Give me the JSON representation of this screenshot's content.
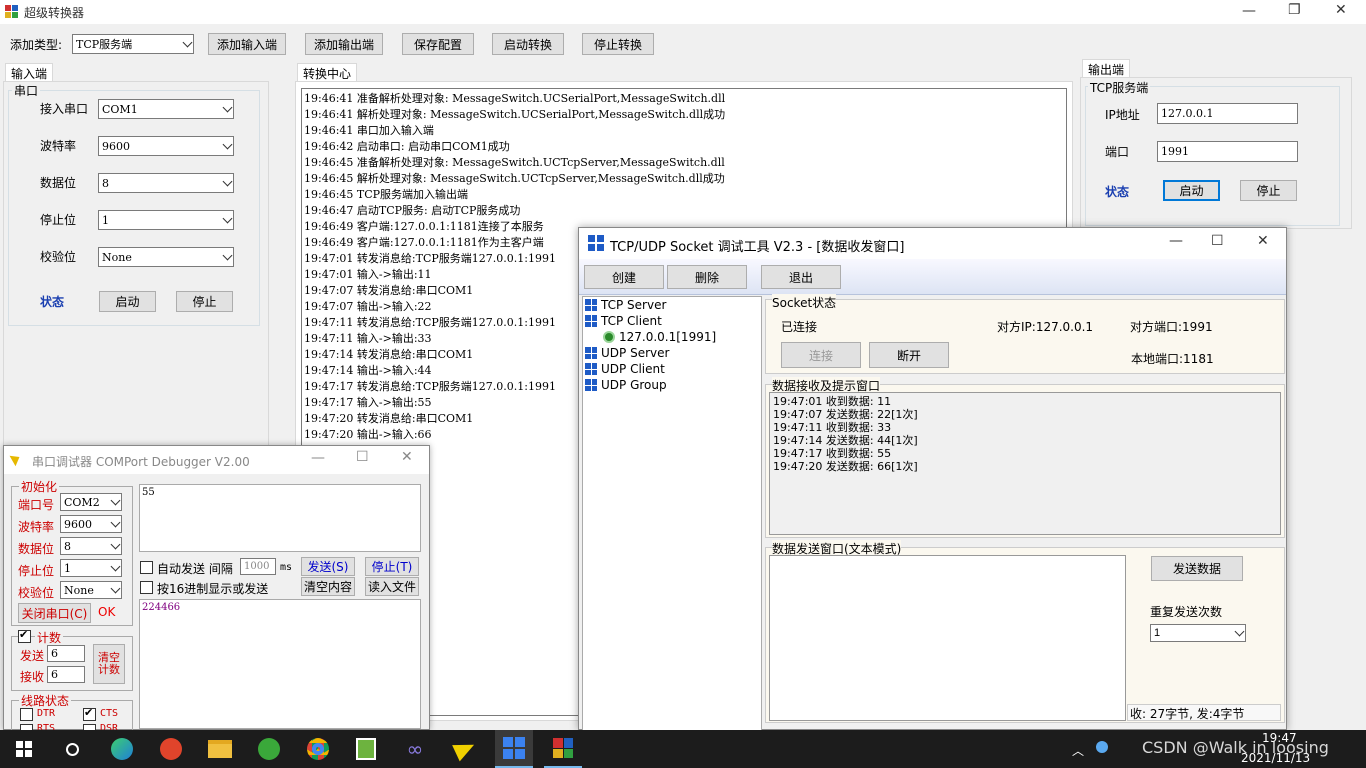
{
  "main_window": {
    "title": "超级转换器",
    "controls": {
      "min": "—",
      "max": "❐",
      "close": "✕"
    },
    "toolbar": {
      "add_type_label": "添加类型:",
      "add_type_value": "TCP服务端",
      "add_input": "添加输入端",
      "add_output": "添加输出端",
      "save_config": "保存配置",
      "start_convert": "启动转换",
      "stop_convert": "停止转换"
    },
    "input_tab": "输入端",
    "input_group": {
      "legend": "串口",
      "port_label": "接入串口",
      "port_value": "COM1",
      "baud_label": "波特率",
      "baud_value": "9600",
      "data_label": "数据位",
      "data_value": "8",
      "stop_label": "停止位",
      "stop_value": "1",
      "parity_label": "校验位",
      "parity_value": "None",
      "status_label": "状态",
      "start": "启动",
      "stop": "停止"
    },
    "center_tab": "转换中心",
    "log": [
      "19:46:41 准备解析处理对象: MessageSwitch.UCSerialPort,MessageSwitch.dll",
      "19:46:41 解析处理对象: MessageSwitch.UCSerialPort,MessageSwitch.dll成功",
      "19:46:41 串口加入输入端",
      "19:46:42 启动串口: 启动串口COM1成功",
      "19:46:45 准备解析处理对象: MessageSwitch.UCTcpServer,MessageSwitch.dll",
      "19:46:45 解析处理对象: MessageSwitch.UCTcpServer,MessageSwitch.dll成功",
      "19:46:45 TCP服务端加入输出端",
      "19:46:47 启动TCP服务: 启动TCP服务成功",
      "19:46:49 客户端:127.0.0.1:1181连接了本服务",
      "19:46:49 客户端:127.0.0.1:1181作为主客户端",
      "19:47:01 转发消息给:TCP服务端127.0.0.1:1991",
      "19:47:01 输入->输出:11",
      "19:47:07 转发消息给:串口COM1",
      "19:47:07 输出->输入:22",
      "19:47:11 转发消息给:TCP服务端127.0.0.1:1991",
      "19:47:11 输入->输出:33",
      "19:47:14 转发消息给:串口COM1",
      "19:47:14 输出->输入:44",
      "19:47:17 转发消息给:TCP服务端127.0.0.1:1991",
      "19:47:17 输入->输出:55",
      "19:47:20 转发消息给:串口COM1",
      "19:47:20 输出->输入:66"
    ],
    "output_tab": "输出端",
    "output_group": {
      "legend": "TCP服务端",
      "ip_label": "IP地址",
      "ip_value": "127.0.0.1",
      "port_label": "端口",
      "port_value": "1991",
      "status_label": "状态",
      "start": "启动",
      "stop": "停止"
    }
  },
  "com_debugger": {
    "title": "串口调试器 COMPort Debugger V2.00",
    "init_legend": "初始化",
    "port_label": "端口号",
    "port_value": "COM2",
    "baud_label": "波特率",
    "baud_value": "9600",
    "data_label": "数据位",
    "data_value": "8",
    "stop_label": "停止位",
    "stop_value": "1",
    "parity_label": "校验位",
    "parity_value": "None",
    "close_port": "关闭串口(C)",
    "ok": "OK",
    "send_text": "55",
    "auto_send_label": "自动发送 间隔",
    "interval_value": "1000",
    "ms": "ms",
    "send_btn": "发送(S)",
    "stop_btn": "停止(T)",
    "hex_label": "按16进制显示或发送",
    "clear_btn": "清空内容",
    "read_file_btn": "读入文件",
    "recv_text": "224466",
    "count_legend": "计数",
    "send_count_label": "发送",
    "send_count": "6",
    "recv_count_label": "接收",
    "recv_count": "6",
    "clear_count": "清空计数",
    "line_legend": "线路状态",
    "dtr": "DTR",
    "cts": "CTS",
    "rts": "RTS",
    "dsr": "DSR"
  },
  "tcp_tool": {
    "title": "TCP/UDP Socket 调试工具 V2.3 - [数据收发窗口]",
    "create": "创建",
    "delete": "删除",
    "exit": "退出",
    "tree": {
      "tcp_server": "TCP Server",
      "tcp_client": "TCP Client",
      "client_item": "127.0.0.1[1991]",
      "udp_server": "UDP Server",
      "udp_client": "UDP Client",
      "udp_group": "UDP Group"
    },
    "socket_legend": "Socket状态",
    "connected": "已连接",
    "peer_ip": "对方IP:127.0.0.1",
    "peer_port": "对方端口:1991",
    "local_port": "本地端口:1181",
    "connect_btn": "连接",
    "disconnect_btn": "断开",
    "recv_legend": "数据接收及提示窗口",
    "recv_lines": [
      "19:47:01 收到数据: 11",
      "19:47:07 发送数据: 22[1次]",
      "19:47:11 收到数据: 33",
      "19:47:14 发送数据: 44[1次]",
      "19:47:17 收到数据: 55",
      "19:47:20 发送数据: 66[1次]"
    ],
    "send_legend": "数据发送窗口(文本模式)",
    "send_btn": "发送数据",
    "repeat_label": "重复发送次数",
    "repeat_value": "1",
    "status_bar": "收: 27字节, 发:4字节"
  },
  "taskbar": {
    "time": "19:47",
    "date": "2021/11/13",
    "watermark": "CSDN @Walk in loosing"
  }
}
